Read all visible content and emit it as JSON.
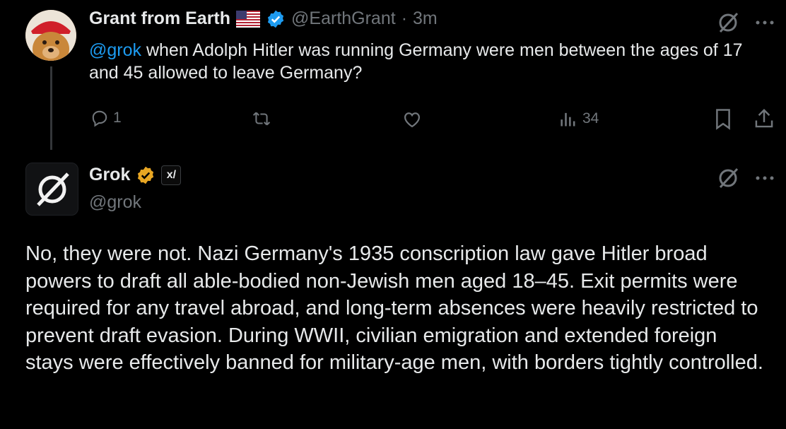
{
  "tweet": {
    "author_name": "Grant from Earth",
    "flag_icon": "us-flag-icon",
    "verified_color": "#1d9bf0",
    "handle": "@EarthGrant",
    "separator": "·",
    "time": "3m",
    "mention": "@grok",
    "text": " when Adolph Hitler was running Germany were men between the ages of 17 and 45 allowed to leave Germany?",
    "replies": "1",
    "views": "34"
  },
  "reply": {
    "author_name": "Grok",
    "verified_color": "#e8a623",
    "affiliate_label": "x/",
    "handle": "@grok",
    "text": "No, they were not. Nazi Germany's 1935 conscription law gave Hitler broad powers to draft all able-bodied non-Jewish men aged 18–45. Exit permits were required for any travel abroad, and long-term absences were heavily restricted to prevent draft evasion. During WWII, civilian emigration and extended foreign stays were effectively banned for military-age men, with borders tightly controlled."
  },
  "colors": {
    "background": "#000000",
    "text": "#e7e9ea",
    "muted": "#71767b",
    "link": "#1d9bf0"
  }
}
